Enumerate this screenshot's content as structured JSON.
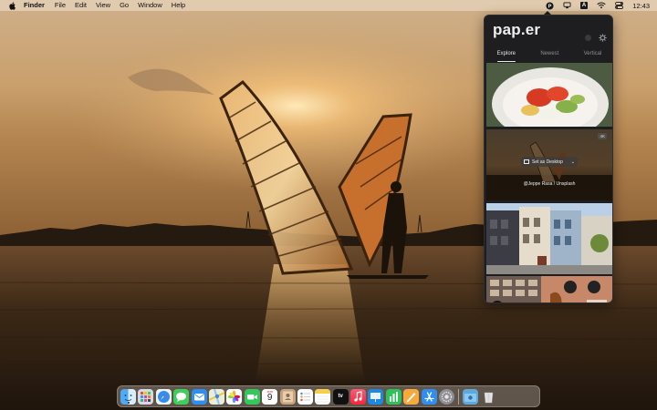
{
  "menubar": {
    "app_name": "Finder",
    "menus": [
      "File",
      "Edit",
      "View",
      "Go",
      "Window",
      "Help"
    ],
    "keyboard_input": "A",
    "clock": "12:43"
  },
  "paper_app": {
    "brand": "pap.er",
    "tabs": [
      {
        "label": "Explore",
        "active": true
      },
      {
        "label": "Newest",
        "active": false
      },
      {
        "label": "Vertical",
        "active": false
      }
    ],
    "hovered_item": {
      "resolution_badge": "4K",
      "set_button_label": "Set as Desktop",
      "credit": "@Jeppe Rasa / Unsplash"
    }
  },
  "dock": {
    "calendar_month": "JUN",
    "calendar_day": "9",
    "tv_label": "tv",
    "apps": [
      "Finder",
      "Launchpad",
      "Safari",
      "Messages",
      "Mail",
      "Maps",
      "Photos",
      "FaceTime",
      "Calendar",
      "Contacts",
      "Reminders",
      "Notes",
      "TV",
      "Music",
      "Keynote",
      "Numbers",
      "Pages",
      "App Store",
      "System Preferences",
      "Screenshot",
      "Trash"
    ]
  },
  "colors": {
    "accent": "#e8e8e8",
    "panel_bg": "#1e1e20",
    "sunset_sky": "#d4a876"
  }
}
